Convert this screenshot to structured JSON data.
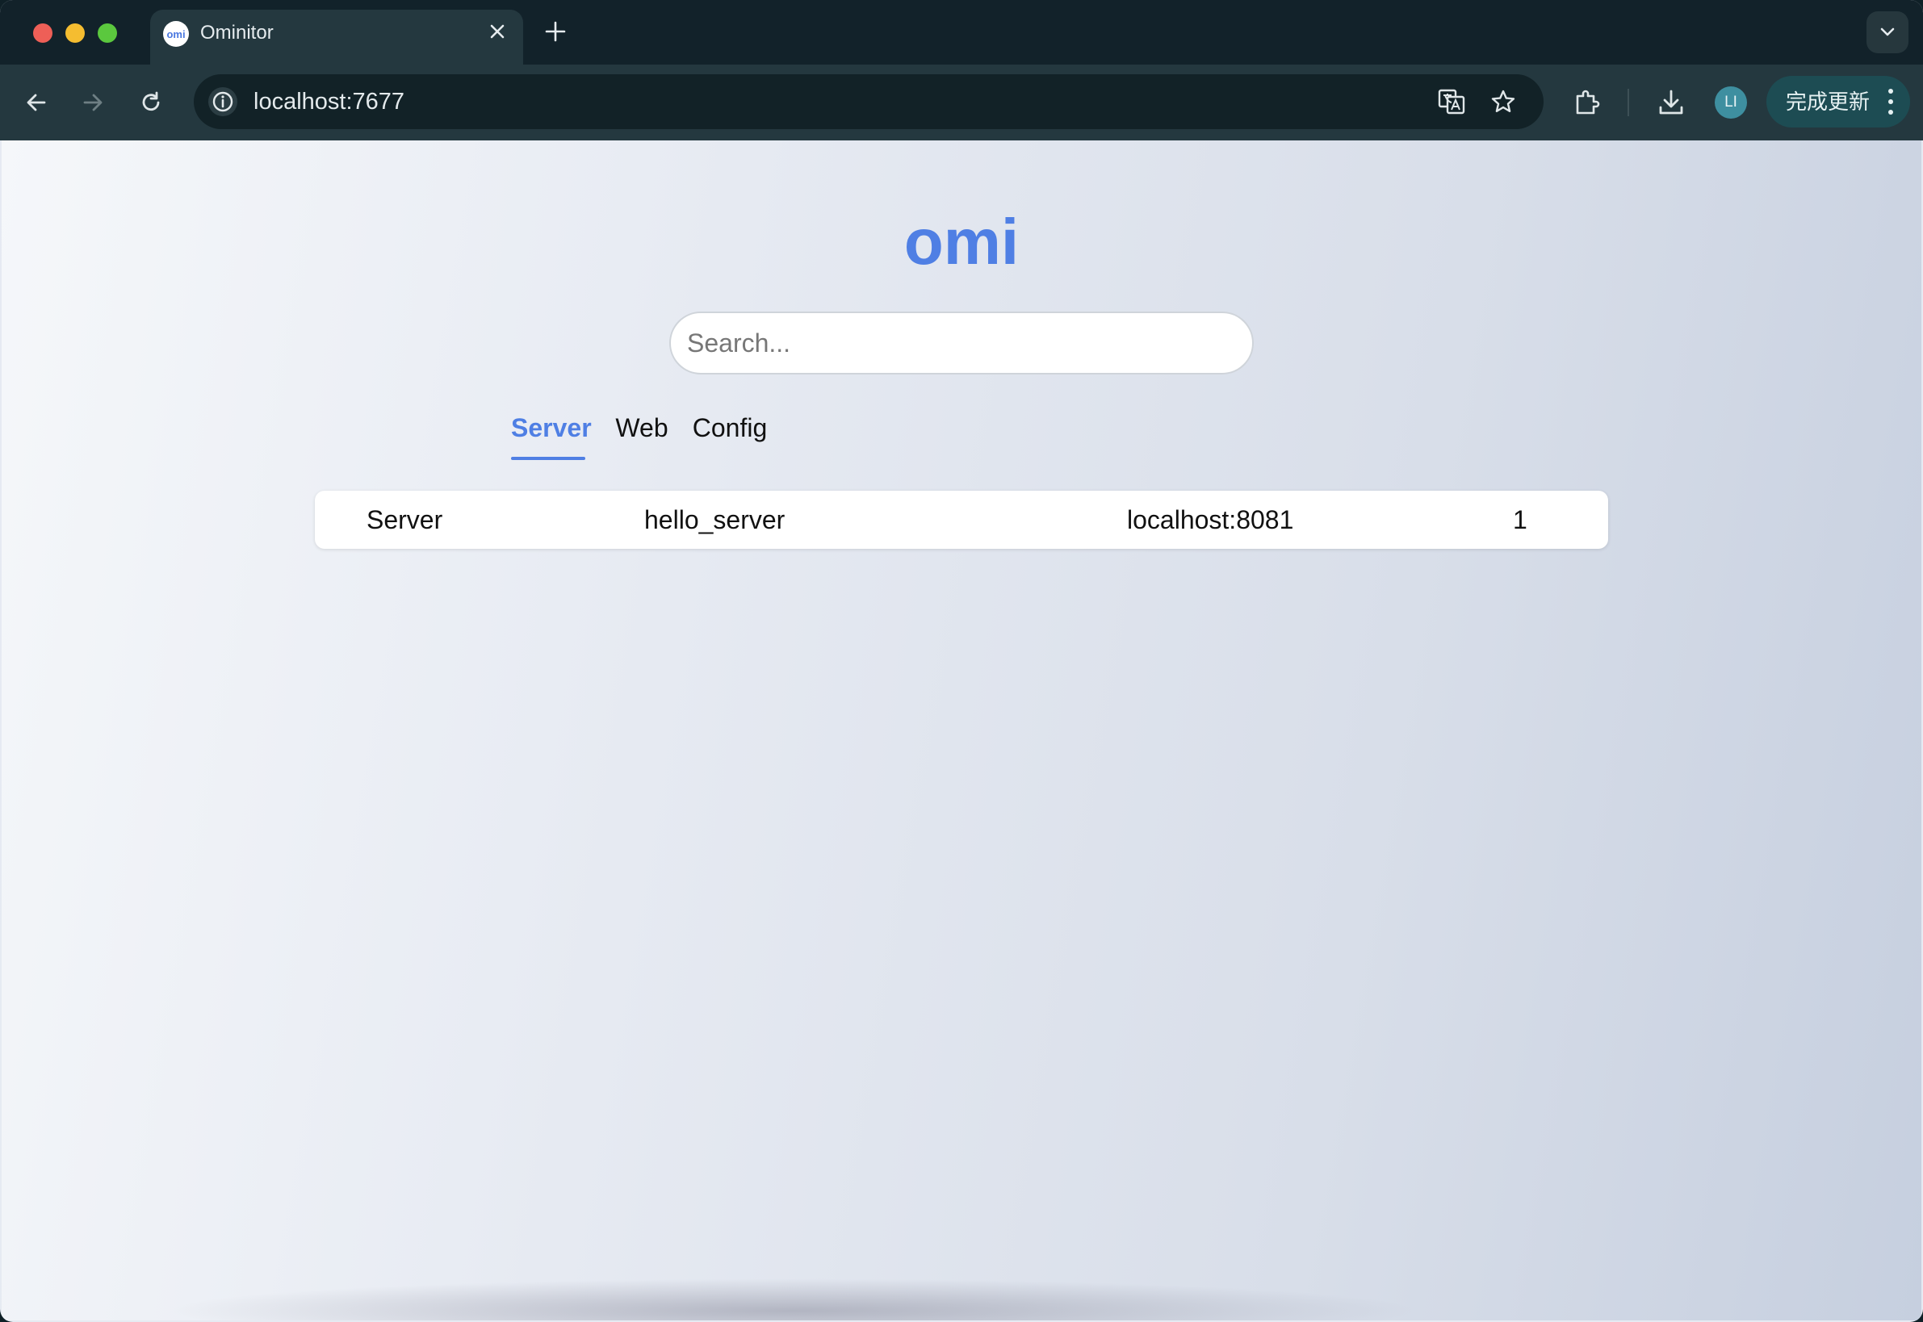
{
  "browser": {
    "tab": {
      "title": "Ominitor",
      "favicon_text": "omi"
    },
    "url": "localhost:7677",
    "profile_initials": "LI",
    "update_button_label": "完成更新",
    "icons": {
      "back": "back-arrow-icon",
      "forward": "forward-arrow-icon",
      "reload": "reload-icon",
      "site_info": "info-icon",
      "translate": "translate-icon",
      "bookmark": "star-icon",
      "extensions": "puzzle-icon",
      "downloads": "download-icon",
      "menu": "kebab-menu-icon"
    }
  },
  "page": {
    "logo": "omi",
    "search": {
      "placeholder": "Search...",
      "value": ""
    },
    "tabs": [
      {
        "label": "Server",
        "active": true
      },
      {
        "label": "Web",
        "active": false
      },
      {
        "label": "Config",
        "active": false
      }
    ],
    "rows": [
      {
        "type": "Server",
        "name": "hello_server",
        "address": "localhost:8081",
        "count": "1"
      }
    ]
  },
  "colors": {
    "accent": "#4f7fe4",
    "tabstrip": "#12222a",
    "toolbar": "#24383f"
  }
}
